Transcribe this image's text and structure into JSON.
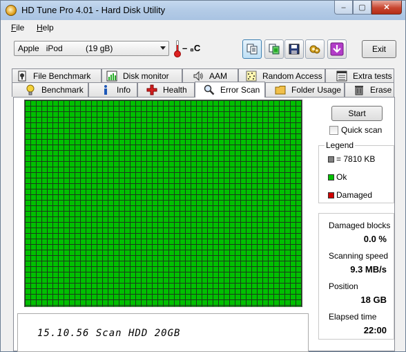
{
  "window": {
    "title": "HD Tune Pro 4.01 - Hard Disk Utility",
    "min": "–",
    "max": "▢",
    "close": "✕"
  },
  "menu": [
    {
      "accel": "F",
      "rest": "ile"
    },
    {
      "accel": "H",
      "rest": "elp"
    }
  ],
  "toolbar": {
    "drive": "Apple   iPod          (19 gB)",
    "temperature": "– ₈C",
    "exit_label": "Exit",
    "icons": [
      "copy-info-icon",
      "copy-screenshot-icon",
      "save-icon",
      "options-icon",
      "download-icon"
    ]
  },
  "tabs_row1": [
    {
      "label": "File Benchmark",
      "icon": "file-benchmark-icon"
    },
    {
      "label": "Disk monitor",
      "icon": "disk-monitor-icon"
    },
    {
      "label": "AAM",
      "icon": "speaker-icon"
    },
    {
      "label": "Random Access",
      "icon": "random-access-icon"
    },
    {
      "label": "Extra tests",
      "icon": "extra-tests-icon"
    }
  ],
  "tabs_row2": [
    {
      "label": "Benchmark",
      "icon": "lightbulb-icon"
    },
    {
      "label": "Info",
      "icon": "info-icon"
    },
    {
      "label": "Health",
      "icon": "health-cross-icon"
    },
    {
      "label": "Error Scan",
      "icon": "magnifier-icon",
      "selected": true
    },
    {
      "label": "Folder Usage",
      "icon": "folder-icon"
    },
    {
      "label": "Erase",
      "icon": "trash-icon"
    }
  ],
  "scan": {
    "start_label": "Start",
    "quick_scan_label": "Quick scan",
    "quick_scan_checked": false,
    "block_colors": {
      "ok": "#00c000",
      "damaged": "#d00000",
      "unit": "#808080"
    },
    "note": "15.10.56 Scan HDD 20GB"
  },
  "legend": {
    "title": "Legend",
    "unit": "= 7810 KB",
    "ok": "Ok",
    "damaged": "Damaged"
  },
  "stats": {
    "damaged_blocks_label": "Damaged blocks",
    "damaged_blocks_value": "0.0 %",
    "scanning_speed_label": "Scanning speed",
    "scanning_speed_value": "9.3 MB/s",
    "position_label": "Position",
    "position_value": "18 GB",
    "elapsed_label": "Elapsed time",
    "elapsed_value": "22:00"
  }
}
